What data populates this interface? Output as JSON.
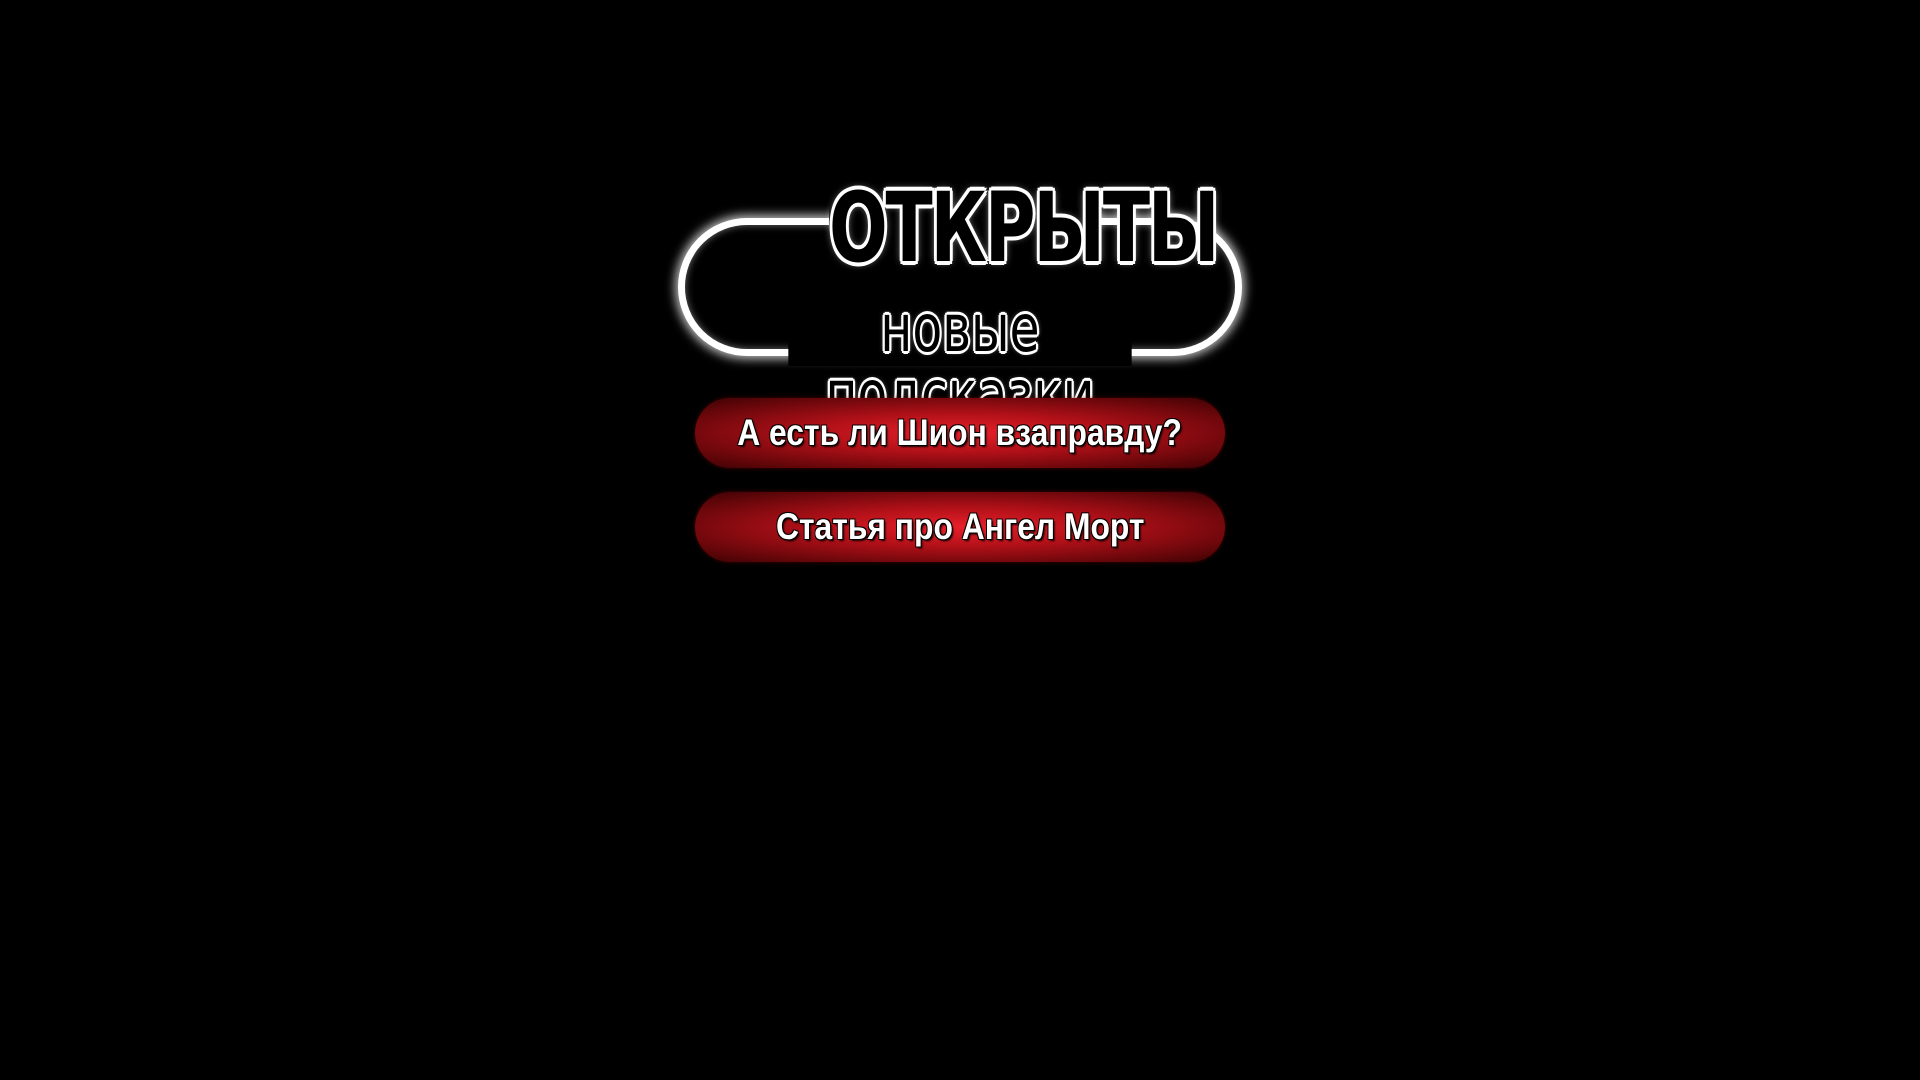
{
  "banner": {
    "title": "ОТКРЫТЫ",
    "subtitle": "новые подсказки"
  },
  "hints": [
    {
      "label": "А есть ли Шион взаправду?"
    },
    {
      "label": "Статья про Ангел Морт"
    }
  ],
  "colors": {
    "background": "#000000",
    "button_red": "#e8202a",
    "button_dark": "#3a0205",
    "text": "#ffffff"
  }
}
